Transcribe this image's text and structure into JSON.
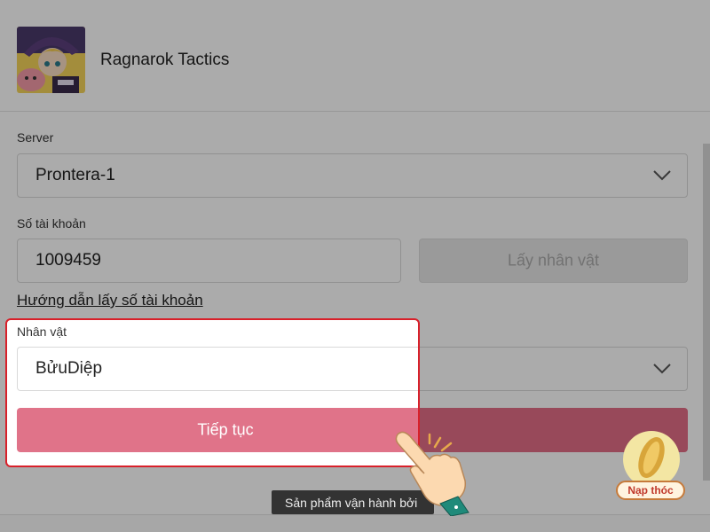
{
  "header": {
    "title": "Ragnarok Tactics"
  },
  "form": {
    "server_label": "Server",
    "server_value": "Prontera-1",
    "account_label": "Số tài khoản",
    "account_value": "1009459",
    "get_character_label": "Lấy nhân vật",
    "guide_link": "Hướng dẫn lấy số tài khoản",
    "character_label": "Nhân vật",
    "character_value": "BửuDiệp",
    "continue_label": "Tiếp tục"
  },
  "footer": {
    "operated_by": "Sản phẩm vận hành bởi"
  },
  "topup": {
    "label": "Nạp thóc"
  },
  "colors": {
    "primary": "#e36d86",
    "highlight_border": "#d8202a"
  }
}
